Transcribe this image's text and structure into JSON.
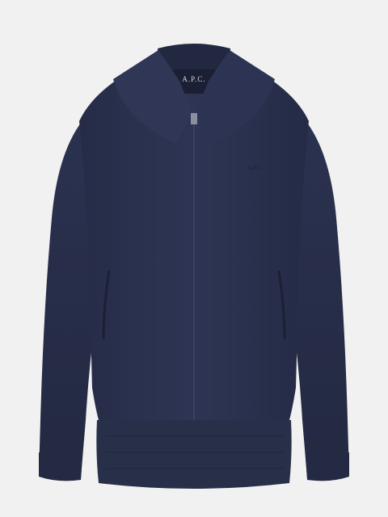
{
  "image": {
    "subject": "jacket",
    "background_color": "#f1f1f1",
    "garment_color": "#2a3150",
    "garment_shadow_color": "#1c2238",
    "garment_highlight_color": "#39405f"
  },
  "labels": {
    "neck_label_text": "A.P.C.",
    "chest_embroidery_text": "A.P.C."
  }
}
